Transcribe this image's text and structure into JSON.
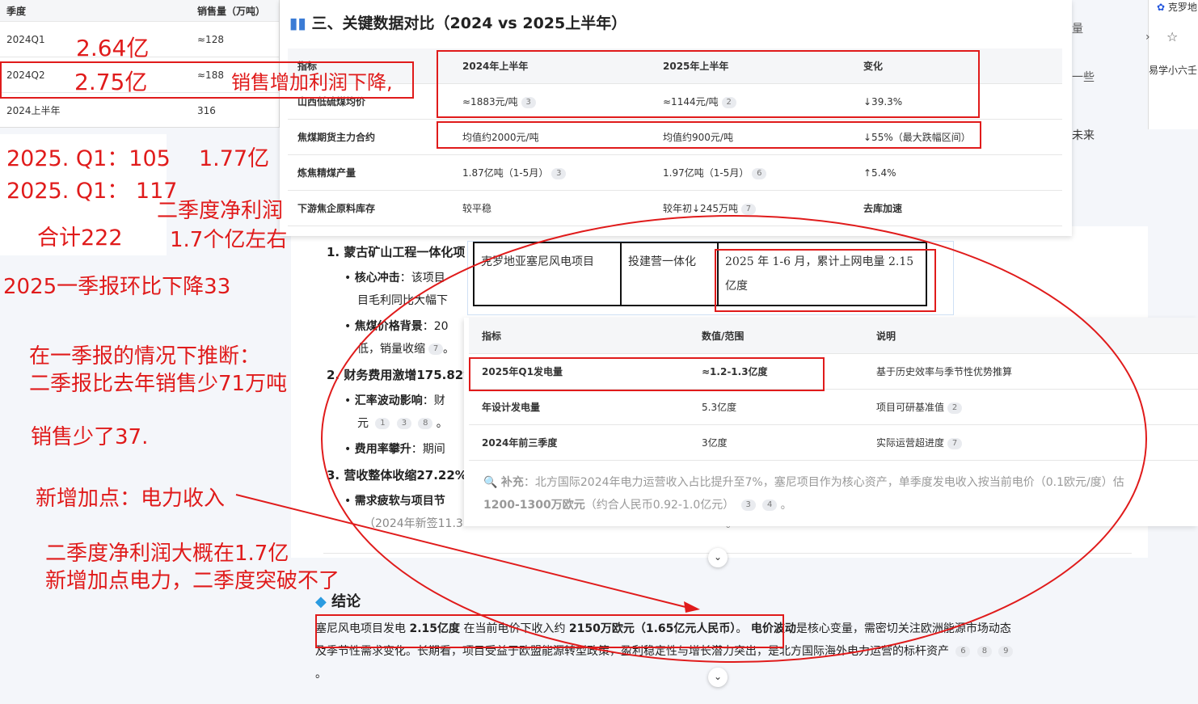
{
  "sales_table": {
    "headers": [
      "季度",
      "销售量（万吨）"
    ],
    "rows": [
      {
        "quarter": "2024Q1",
        "value": "≈128"
      },
      {
        "quarter": "2024Q2",
        "value": "≈188"
      },
      {
        "quarter": "2024上半年",
        "value": "316"
      }
    ]
  },
  "key_data": {
    "title": "三、关键数据对比（2024 vs 2025上半年）",
    "headers": [
      "指标",
      "2024年上半年",
      "2025年上半年",
      "变化"
    ],
    "rows": [
      {
        "c1": "山西低硫煤均价",
        "c2": "≈1883元/吨",
        "c2cite": "3",
        "c3": "≈1144元/吨",
        "c3cite": "2",
        "c4": "↓39.3%"
      },
      {
        "c1": "焦煤期货主力合约",
        "c2": "均值约2000元/吨",
        "c3": "均值约900元/吨",
        "c4": "↓55%（最大跌幅区间）"
      },
      {
        "c1": "炼焦精煤产量",
        "c2": "1.87亿吨（1-5月）",
        "c2cite": "3",
        "c3": "1.97亿吨（1-5月）",
        "c3cite": "6",
        "c4": "↑5.4%"
      },
      {
        "c1": "下游焦企原料库存",
        "c2": "较平稳",
        "c3": "较年初↓245万吨",
        "c3cite": "7",
        "c4": "去库加速"
      }
    ]
  },
  "article": {
    "item1_title": "1. 蒙古矿山工程一体化项",
    "b1_label": "核心冲击",
    "b1_text": "：该项目",
    "b1_line2": "目毛利同比大幅下",
    "b2_label": "焦煤价格背景",
    "b2_text": "：20",
    "b2_line2": "低，销量收缩",
    "b2_cite": "7",
    "item2_title": "2. 财务费用激增175.82%",
    "b3_label": "汇率波动影响",
    "b3_text": "：财",
    "b3_line2": "元",
    "b3_cites": [
      "1",
      "3",
      "8"
    ],
    "b4_label": "费用率攀升",
    "b4_text": "：期间",
    "item3_title": "3. 营收整体收缩27.22%",
    "b5_label": "需求疲软与项目节",
    "b5_line2": "（2024年新签11.3",
    "b5_tail": "。",
    "right_frag1": "量",
    "right_frag2": "一些",
    "right_frag3": "未来"
  },
  "wind_table": {
    "cells": [
      "克罗地亚塞尼风电项目",
      "投建营一体化",
      "2025 年 1-6 月，累计上网电量 2.15 亿度"
    ]
  },
  "power_table": {
    "headers": [
      "指标",
      "数值/范围",
      "说明"
    ],
    "rows": [
      {
        "c1": "2025年Q1发电量",
        "c2": "≈1.2-1.3亿度",
        "c3": "基于历史效率与季节性优势推算"
      },
      {
        "c1": "年设计发电量",
        "c2": "5.3亿度",
        "c3": "项目可研基准值",
        "c3cite": "2"
      },
      {
        "c1": "2024年前三季度",
        "c2": "3亿度",
        "c3": "实际运营超进度",
        "c3cite": "7"
      }
    ],
    "supplement_label": "补充",
    "supplement_text": "：北方国际2024年电力运营收入占比提升至7%，塞尼项目作为核心资产，单季度发电收入按当前电价（0.1",
    "supplement_text2": "欧元/度）估",
    "supplement_bold": "1200-1300万欧元",
    "supplement_rest": "（约合人民币0.92-1.0亿元）",
    "supplement_cites": [
      "3",
      "4"
    ]
  },
  "conclusion": {
    "title": "结论",
    "p1_a": "塞尼风电项目发电 ",
    "p1_b": "2.15亿度",
    "p1_c": " 在当前电价下收入约 ",
    "p1_d": "2150万欧元（1.65亿元人民币）",
    "p1_e": "。",
    "p1_f": "电价波动",
    "p1_g": "是核心变量，需密切关注欧洲能源市场动态",
    "p2": "及季节性需求变化。长期看，项目受益于欧盟能源转型政策，盈利稳定性与增长潜力突出，是北方国际海外电力运营的标杆资产",
    "cites": [
      "6",
      "8",
      "9"
    ]
  },
  "top_right": {
    "tab_text": "克罗地",
    "side_text": "易学小六壬"
  },
  "annotations": {
    "q1_profit": "2.64亿",
    "q2_profit": "2.75亿",
    "sales_up": "销售增加利润下降,",
    "q1_2025_a": "2025. Q1：105",
    "q1_2025_b": "2025. Q1：  117",
    "profit_177": "1.77亿",
    "q2_net_a": "二季度净利润",
    "q2_net_b": "1.7个亿左右",
    "total": "合计222",
    "q1_drop": "2025一季报环比下降33",
    "infer_a": "在一季报的情况下推断：",
    "infer_b": "二季报比去年销售少71万吨",
    "sales_less": "销售少了37.",
    "new_point": "新增加点：电力收入",
    "q2_net_c": "二季度净利润大概在1.7亿",
    "q2_net_d": "新增加点电力，二季度突破不了"
  },
  "colors": {
    "annotation_red": "#e01b1b",
    "header_bg": "#f5f6f8"
  }
}
